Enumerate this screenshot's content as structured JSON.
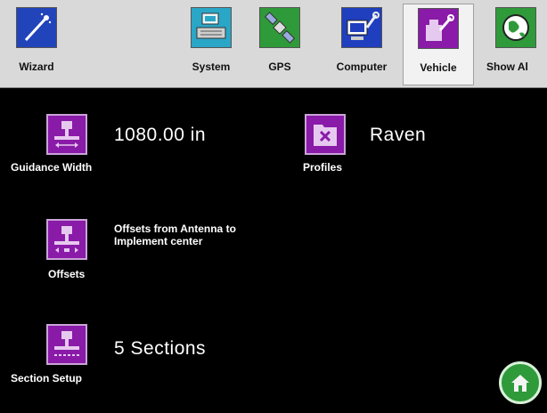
{
  "tabs": [
    {
      "label": "Wizard",
      "icon": "wizard-wand-icon",
      "active": false
    },
    {
      "label": "System",
      "icon": "system-monitor-icon",
      "active": false
    },
    {
      "label": "GPS",
      "icon": "gps-satellite-icon",
      "active": false
    },
    {
      "label": "Computer",
      "icon": "computer-wrench-icon",
      "active": false
    },
    {
      "label": "Vehicle",
      "icon": "vehicle-wrench-icon",
      "active": true
    },
    {
      "label": "Show Al",
      "icon": "globe-icon",
      "active": false
    }
  ],
  "colors": {
    "wizard": "#2244bb",
    "system": "#2aa6c7",
    "gps": "#2f9a3a",
    "computer": "#1f3fbf",
    "vehicle": "#8a1aa8",
    "showall": "#2f9a3a"
  },
  "items": {
    "guidance_width": {
      "label": "Guidance Width",
      "value": "1080.00  in"
    },
    "profiles": {
      "label": "Profiles",
      "value": "Raven"
    },
    "offsets": {
      "label": "Offsets",
      "desc": "Offsets from Antenna to Implement center"
    },
    "section_setup": {
      "label": "Section Setup",
      "value": "5 Sections"
    }
  },
  "home": {
    "icon": "home-icon"
  }
}
